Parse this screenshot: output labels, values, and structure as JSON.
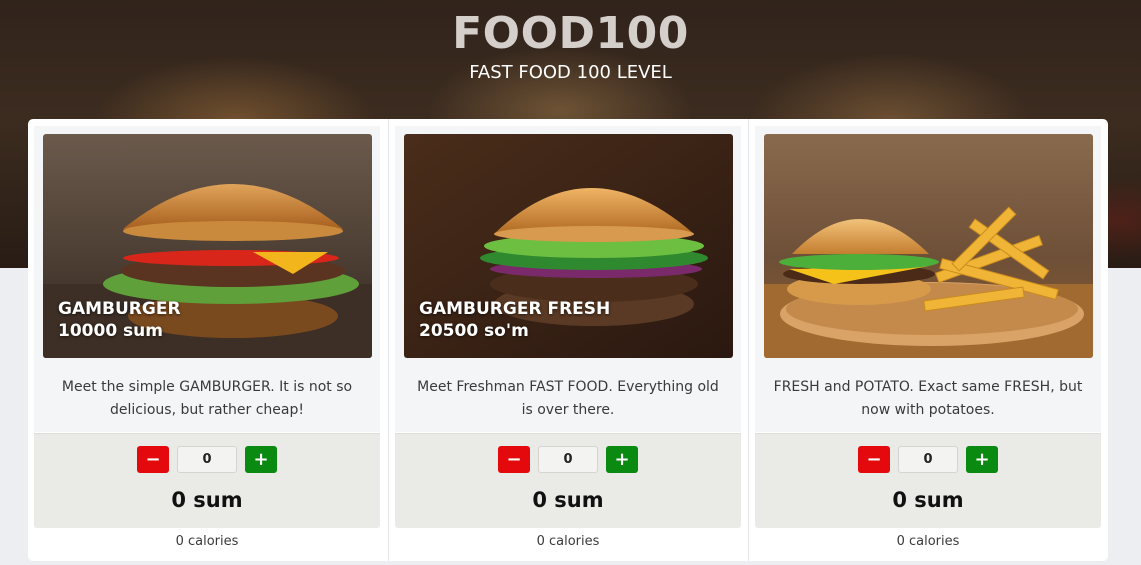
{
  "header": {
    "title": "FOOD100",
    "subtitle": "FAST FOOD 100 LEVEL"
  },
  "colors": {
    "minus_button": "#e3090c",
    "plus_button": "#0b8a12",
    "panel_background": "#ffffff",
    "counter_area": "#eaeae6"
  },
  "products": [
    {
      "name": "GAMBURGER",
      "price": "10000 sum",
      "image": "burger-photo",
      "description": "Meet the simple GAMBURGER. It is not so delicious, but rather cheap!",
      "minus_label": "−",
      "plus_label": "+",
      "quantity": "0",
      "total": "0 sum",
      "calories": "0 calories"
    },
    {
      "name": "GAMBURGER FRESH",
      "price": "20500 so'm",
      "image": "fresh-burger-photo",
      "description": "Meet Freshman FAST FOOD. Everything old is over there.",
      "minus_label": "−",
      "plus_label": "+",
      "quantity": "0",
      "total": "0 sum",
      "calories": "0 calories"
    },
    {
      "name": "",
      "price": "",
      "image": "burger-and-fries-photo",
      "description": "FRESH and POTATO. Exact same FRESH, but now with potatoes.",
      "minus_label": "−",
      "plus_label": "+",
      "quantity": "0",
      "total": "0 sum",
      "calories": "0 calories"
    }
  ]
}
